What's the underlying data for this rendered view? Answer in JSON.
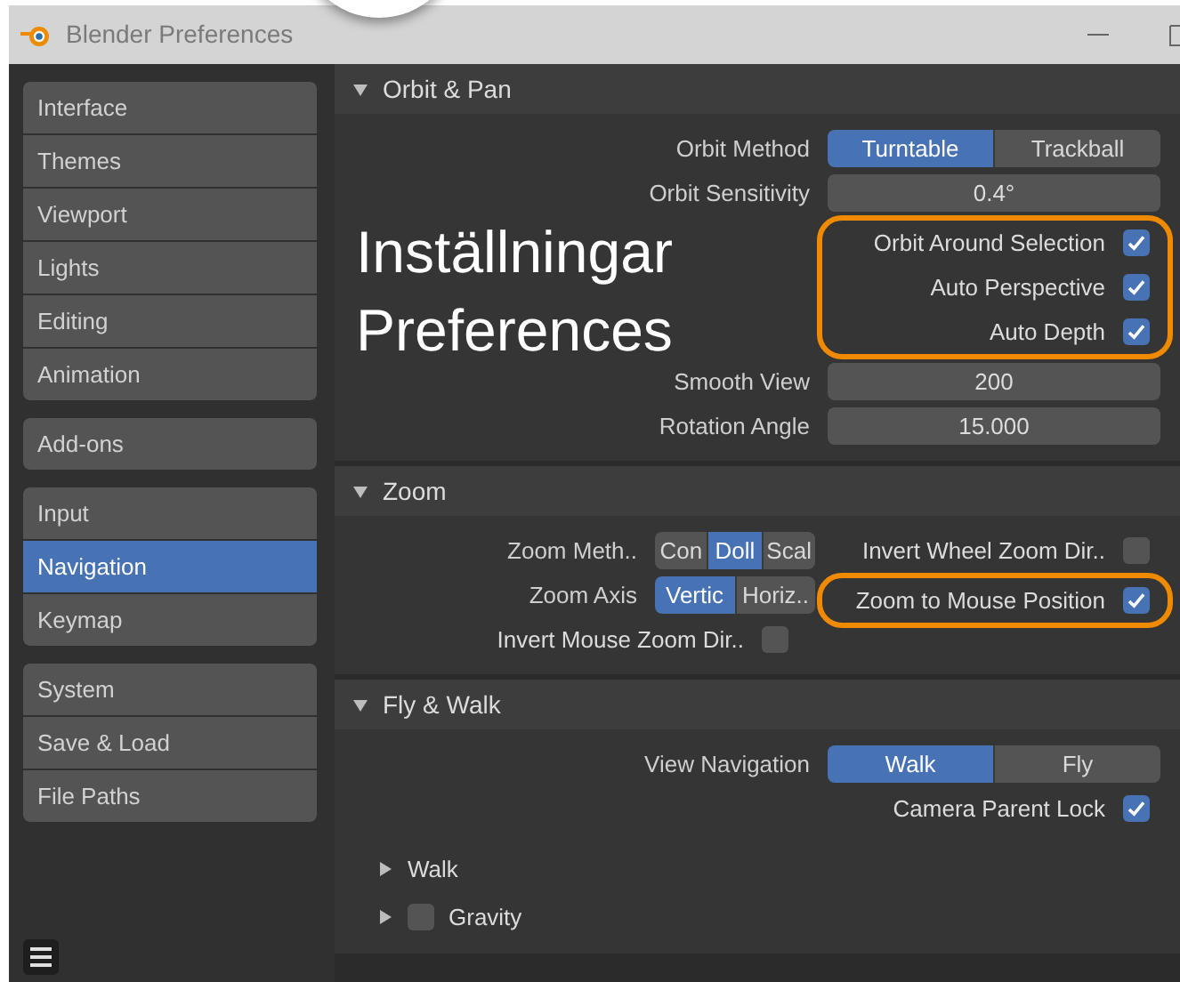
{
  "window": {
    "title": "Blender Preferences"
  },
  "sidebar": {
    "groups": [
      [
        {
          "label": "Interface",
          "selected": false
        },
        {
          "label": "Themes",
          "selected": false
        },
        {
          "label": "Viewport",
          "selected": false
        },
        {
          "label": "Lights",
          "selected": false
        },
        {
          "label": "Editing",
          "selected": false
        },
        {
          "label": "Animation",
          "selected": false
        }
      ],
      [
        {
          "label": "Add-ons",
          "selected": false
        }
      ],
      [
        {
          "label": "Input",
          "selected": false
        },
        {
          "label": "Navigation",
          "selected": true
        },
        {
          "label": "Keymap",
          "selected": false
        }
      ],
      [
        {
          "label": "System",
          "selected": false
        },
        {
          "label": "Save & Load",
          "selected": false
        },
        {
          "label": "File Paths",
          "selected": false
        }
      ]
    ]
  },
  "annotation": {
    "lines": [
      "Inställningar",
      "Preferences"
    ]
  },
  "sections": [
    {
      "title": "Orbit & Pan",
      "expanded": true,
      "rows": [
        {
          "kind": "toggle",
          "label": "Orbit Method",
          "options": [
            {
              "label": "Turntable",
              "selected": true
            },
            {
              "label": "Trackball",
              "selected": false
            }
          ]
        },
        {
          "kind": "field",
          "label": "Orbit Sensitivity",
          "value": "0.4°"
        },
        {
          "kind": "group",
          "highlighted": true,
          "rows": [
            {
              "kind": "checkbox",
              "label": "Orbit Around Selection",
              "checked": true
            },
            {
              "kind": "checkbox",
              "label": "Auto Perspective",
              "checked": true
            },
            {
              "kind": "checkbox",
              "label": "Auto Depth",
              "checked": true
            }
          ]
        },
        {
          "kind": "field",
          "label": "Smooth View",
          "value": "200"
        },
        {
          "kind": "field",
          "label": "Rotation Angle",
          "value": "15.000"
        }
      ]
    },
    {
      "title": "Zoom",
      "expanded": true,
      "left": [
        {
          "kind": "toggle",
          "label": "Zoom Meth..",
          "options": [
            {
              "label": "Con",
              "selected": false
            },
            {
              "label": "Doll",
              "selected": true
            },
            {
              "label": "Scal",
              "selected": false
            }
          ]
        },
        {
          "kind": "toggle",
          "label": "Zoom Axis",
          "options": [
            {
              "label": "Vertic",
              "selected": true
            },
            {
              "label": "Horiz..",
              "selected": false
            }
          ]
        },
        {
          "kind": "checkbox",
          "label": "Invert Mouse Zoom Dir..",
          "checked": false
        }
      ],
      "right": [
        {
          "kind": "checkbox",
          "label": "Invert Wheel Zoom Dir..",
          "checked": false
        },
        {
          "kind": "group",
          "highlighted": true,
          "rows": [
            {
              "kind": "checkbox",
              "label": "Zoom to Mouse Position",
              "checked": true
            }
          ]
        }
      ]
    },
    {
      "title": "Fly & Walk",
      "expanded": true,
      "rows": [
        {
          "kind": "toggle",
          "label": "View Navigation",
          "options": [
            {
              "label": "Walk",
              "selected": true
            },
            {
              "label": "Fly",
              "selected": false
            }
          ]
        },
        {
          "kind": "checkbox",
          "label": "Camera Parent Lock",
          "checked": true
        },
        {
          "kind": "subpanel",
          "label": "Walk",
          "expanded": false
        },
        {
          "kind": "subpanel",
          "label": "Gravity",
          "expanded": false,
          "checked": false
        }
      ]
    }
  ]
}
